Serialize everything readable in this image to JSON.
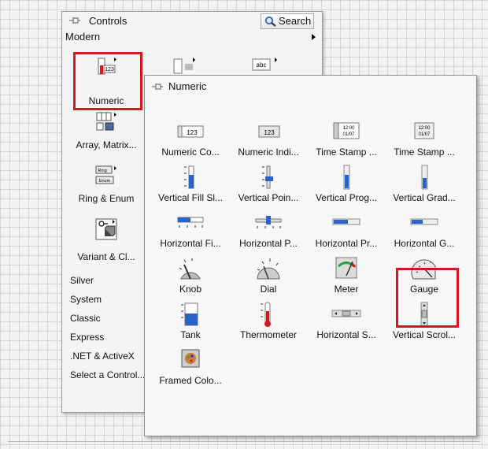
{
  "controls": {
    "title": "Controls",
    "search_label": "Search",
    "modern_label": "Modern",
    "icons": [
      {
        "label": "Numeric",
        "icon": "numeric-icon"
      },
      {
        "label": "Array, Matrix...",
        "icon": "array-icon"
      },
      {
        "label": "Ring & Enum",
        "icon": "ring-enum-icon"
      },
      {
        "label": "Variant & Cl...",
        "icon": "variant-icon"
      }
    ],
    "list": [
      "Silver",
      "System",
      "Classic",
      "Express",
      ".NET & ActiveX",
      "Select a Control..."
    ]
  },
  "numeric": {
    "title": "Numeric",
    "items": [
      {
        "label": "Numeric Co...",
        "icon": "numeric-control-icon"
      },
      {
        "label": "Numeric Indi...",
        "icon": "numeric-indicator-icon"
      },
      {
        "label": "Time Stamp ...",
        "icon": "time-stamp-control-icon",
        "ts": "12:00\n01/07"
      },
      {
        "label": "Time Stamp ...",
        "icon": "time-stamp-indicator-icon",
        "ts": "12:00\n01/07"
      },
      {
        "label": "Vertical Fill Sl...",
        "icon": "vertical-fill-slide-icon"
      },
      {
        "label": "Vertical Poin...",
        "icon": "vertical-pointer-slide-icon"
      },
      {
        "label": "Vertical Prog...",
        "icon": "vertical-progress-bar-icon"
      },
      {
        "label": "Vertical Grad...",
        "icon": "vertical-graduated-bar-icon"
      },
      {
        "label": "Horizontal Fi...",
        "icon": "horizontal-fill-slide-icon"
      },
      {
        "label": "Horizontal P...",
        "icon": "horizontal-pointer-slide-icon"
      },
      {
        "label": "Horizontal Pr...",
        "icon": "horizontal-progress-bar-icon"
      },
      {
        "label": "Horizontal G...",
        "icon": "horizontal-graduated-bar-icon"
      },
      {
        "label": "Knob",
        "icon": "knob-icon"
      },
      {
        "label": "Dial",
        "icon": "dial-icon"
      },
      {
        "label": "Meter",
        "icon": "meter-icon"
      },
      {
        "label": "Gauge",
        "icon": "gauge-icon"
      },
      {
        "label": "Tank",
        "icon": "tank-icon"
      },
      {
        "label": "Thermometer",
        "icon": "thermometer-icon"
      },
      {
        "label": "Horizontal S...",
        "icon": "horizontal-scrollbar-icon"
      },
      {
        "label": "Vertical Scrol...",
        "icon": "vertical-scrollbar-icon"
      },
      {
        "label": "Framed Colo...",
        "icon": "framed-color-box-icon"
      }
    ]
  },
  "icon_texts": {
    "num": "123",
    "abc": "abc",
    "ring": "Ring",
    "enum": "Enum"
  },
  "colors": {
    "highlight": "#d4181f",
    "accent_blue": "#2b64c8"
  }
}
